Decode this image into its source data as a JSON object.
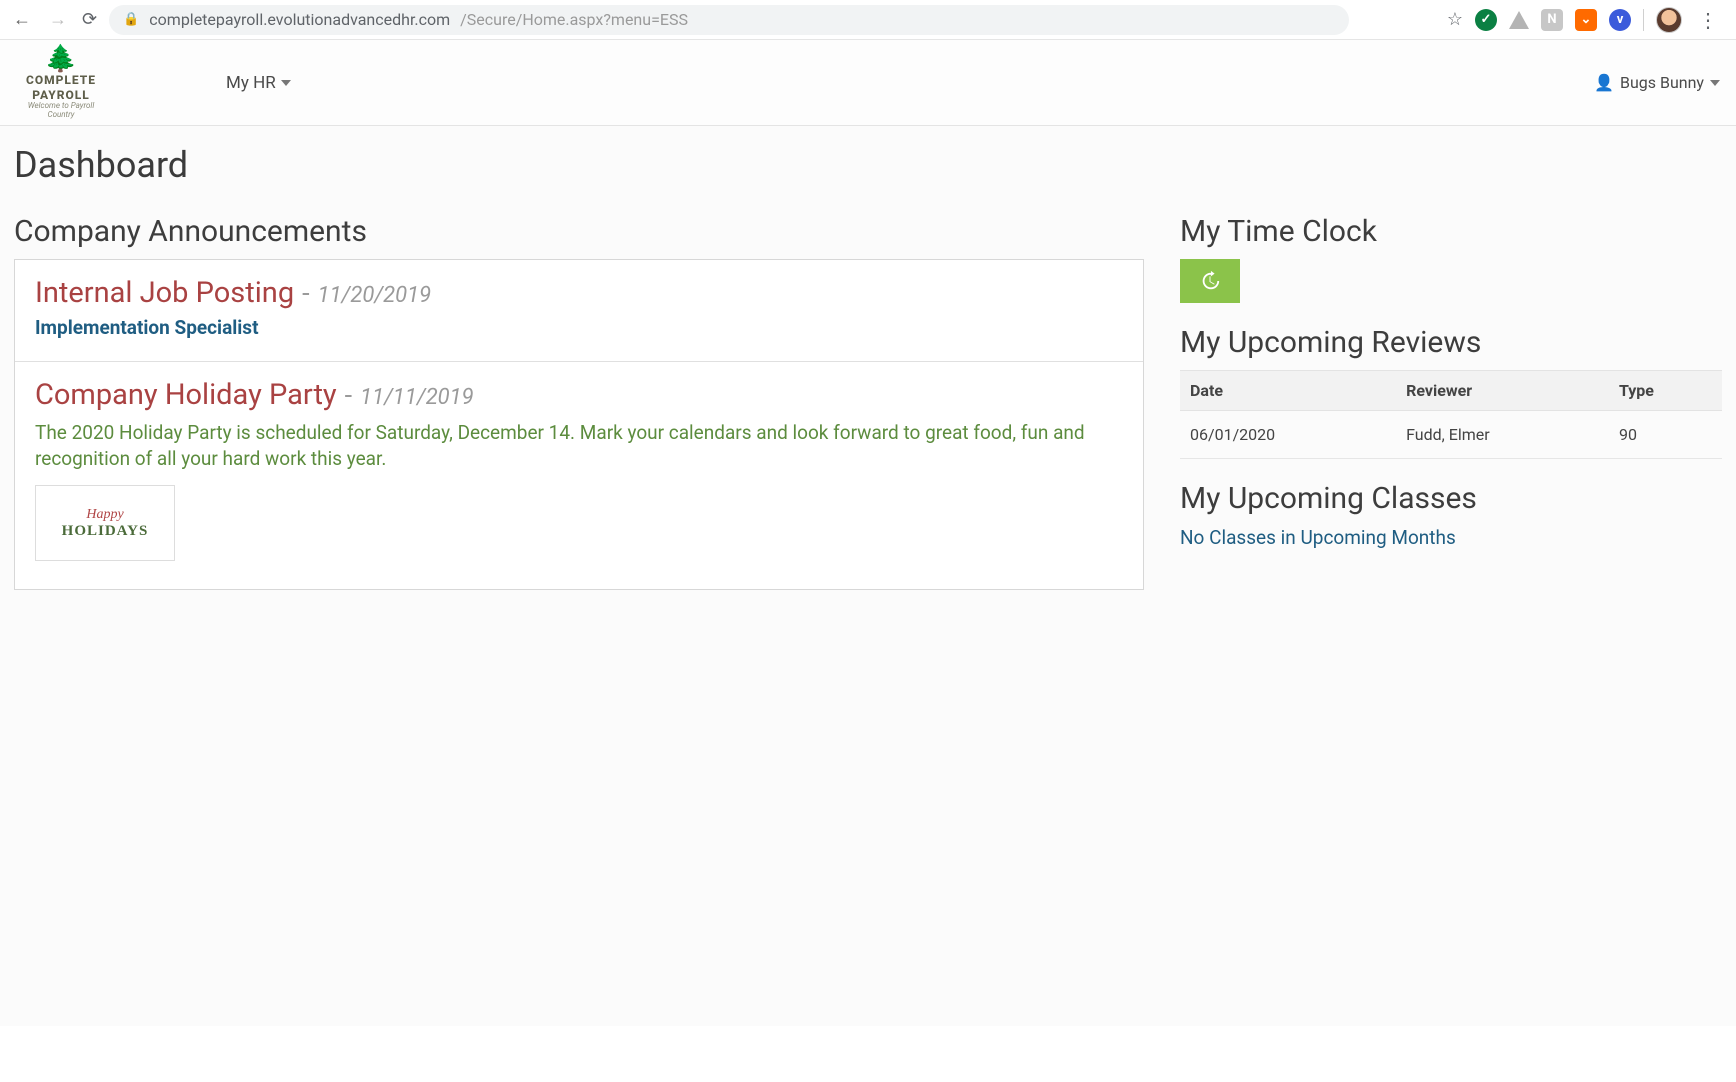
{
  "browser": {
    "url_host": "completepayroll.evolutionadvancedhr.com",
    "url_path": "/Secure/Home.aspx?menu=ESS"
  },
  "header": {
    "nav_myhr": "My HR",
    "user_name": "Bugs Bunny",
    "brand_line1": "COMPLETE",
    "brand_line2": "PAYROLL",
    "brand_tag": "Welcome to Payroll Country"
  },
  "page": {
    "title": "Dashboard"
  },
  "announcements": {
    "heading": "Company Announcements",
    "items": [
      {
        "title": "Internal Job Posting",
        "date": "11/20/2019",
        "link": "Implementation Specialist",
        "body": null,
        "has_image": false
      },
      {
        "title": "Company Holiday Party",
        "date": "11/11/2019",
        "link": null,
        "body": "The 2020 Holiday Party is scheduled for Saturday, December 14. Mark your calendars and look forward to great food, fun and recognition of all your hard work this year.",
        "has_image": true,
        "image_line1": "Happy",
        "image_line2": "HOLIDAYS"
      }
    ]
  },
  "timeclock": {
    "heading": "My Time Clock"
  },
  "reviews": {
    "heading": "My Upcoming Reviews",
    "cols": {
      "date": "Date",
      "reviewer": "Reviewer",
      "type": "Type"
    },
    "rows": [
      {
        "date": "06/01/2020",
        "reviewer": "Fudd, Elmer",
        "type": "90"
      }
    ]
  },
  "classes": {
    "heading": "My Upcoming Classes",
    "empty": "No Classes in Upcoming Months"
  }
}
